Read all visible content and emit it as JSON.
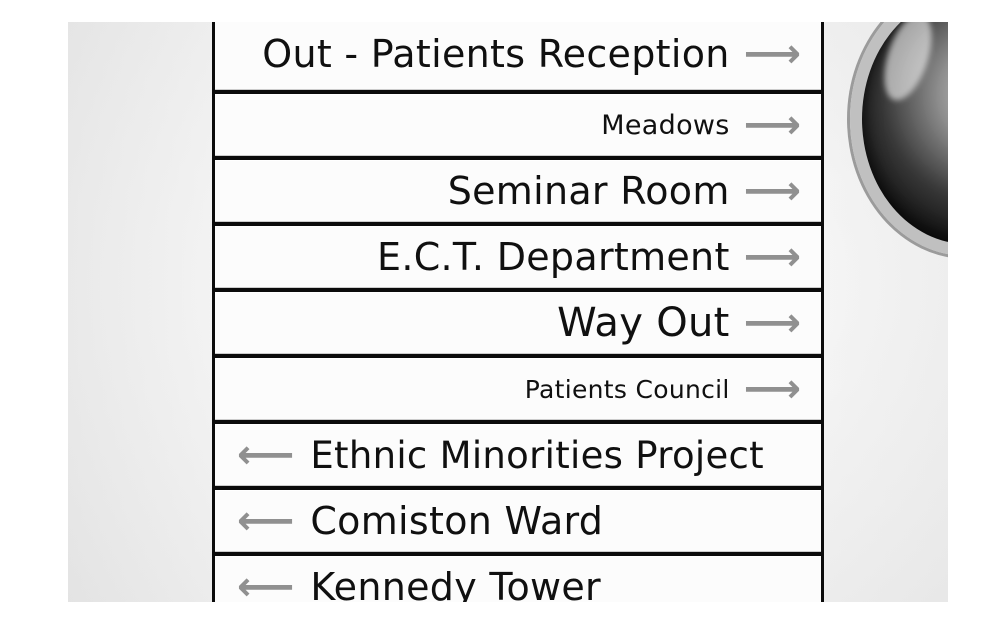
{
  "sign": {
    "panels": [
      {
        "label": "Out - Patients Reception",
        "direction": "right",
        "arrow_icon": "right-arrow-icon"
      },
      {
        "label": "Meadows",
        "direction": "right",
        "arrow_icon": "right-arrow-icon"
      },
      {
        "label": "Seminar Room",
        "direction": "right",
        "arrow_icon": "right-arrow-icon"
      },
      {
        "label": "E.C.T. Department",
        "direction": "right",
        "arrow_icon": "right-arrow-icon"
      },
      {
        "label": "Way Out",
        "direction": "right",
        "arrow_icon": "right-arrow-icon"
      },
      {
        "label": "Patients Council",
        "direction": "right",
        "arrow_icon": "right-arrow-icon"
      },
      {
        "label": "Ethnic Minorities Project",
        "direction": "left",
        "arrow_icon": "left-arrow-icon"
      },
      {
        "label": "Comiston Ward",
        "direction": "left",
        "arrow_icon": "left-arrow-icon"
      },
      {
        "label": "Kennedy Tower",
        "direction": "left",
        "arrow_icon": "left-arrow-icon"
      }
    ]
  },
  "colors": {
    "panel": "#f6f6f6",
    "text": "#151515",
    "arrow": "#8f8f8f",
    "frame": "#111111",
    "wall": "#f2f2f2"
  }
}
